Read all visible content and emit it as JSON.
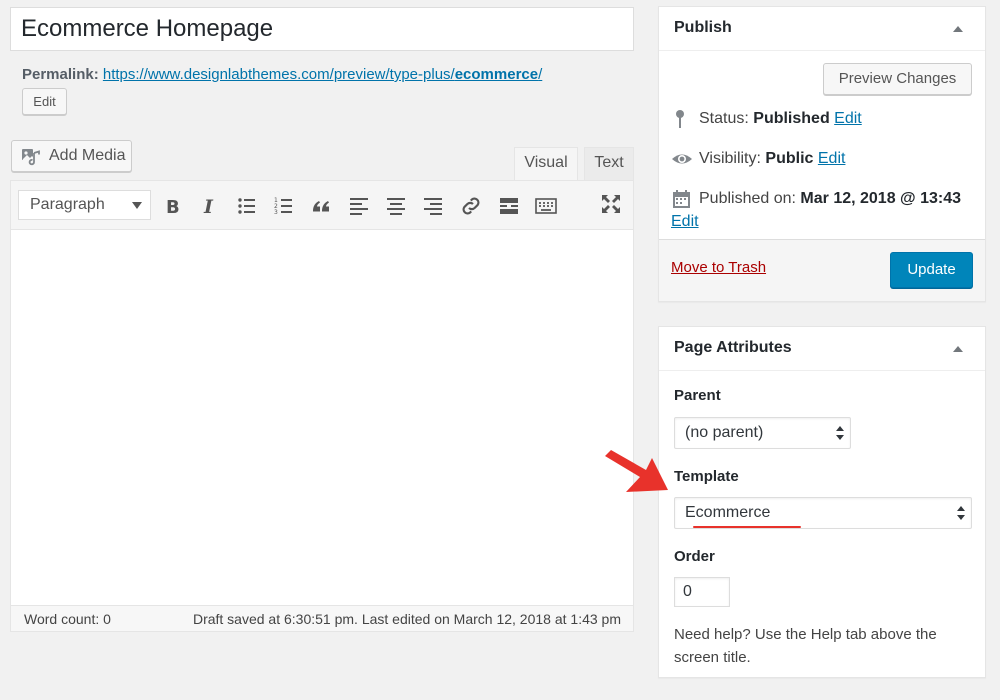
{
  "editor": {
    "title": "Ecommerce Homepage",
    "permalink_label": "Permalink:",
    "permalink_base": "https://www.designlabthemes.com/preview/type-plus/",
    "permalink_slug": "ecommerce",
    "permalink_trail": "/",
    "edit_label": "Edit",
    "add_media_label": "Add Media",
    "tabs": {
      "visual": "Visual",
      "text": "Text"
    },
    "format_select_value": "Paragraph",
    "word_count": "Word count: 0",
    "saved_status": "Draft saved at 6:30:51 pm. Last edited on March 12, 2018 at 1:43 pm"
  },
  "publish": {
    "title": "Publish",
    "preview_label": "Preview Changes",
    "status_label": "Status:",
    "status_value": "Published",
    "visibility_label": "Visibility:",
    "visibility_value": "Public",
    "published_on_label": "Published on:",
    "published_on_value": "Mar 12, 2018 @ 13:43",
    "edit_label": "Edit",
    "trash_label": "Move to Trash",
    "update_label": "Update"
  },
  "attributes": {
    "title": "Page Attributes",
    "parent_label": "Parent",
    "parent_value": "(no parent)",
    "template_label": "Template",
    "template_value": "Ecommerce",
    "order_label": "Order",
    "order_value": "0",
    "help_text": "Need help? Use the Help tab above the screen title."
  },
  "colors": {
    "link": "#0073aa",
    "primary_button": "#0085ba",
    "trash": "#aa0000",
    "annotation": "#e8322b"
  },
  "icons": {
    "toolbar": [
      "bold-icon",
      "italic-icon",
      "bullet-list-icon",
      "numbered-list-icon",
      "blockquote-icon",
      "align-left-icon",
      "align-center-icon",
      "align-right-icon",
      "link-icon",
      "read-more-icon",
      "toolbar-toggle-icon",
      "fullscreen-icon"
    ]
  }
}
